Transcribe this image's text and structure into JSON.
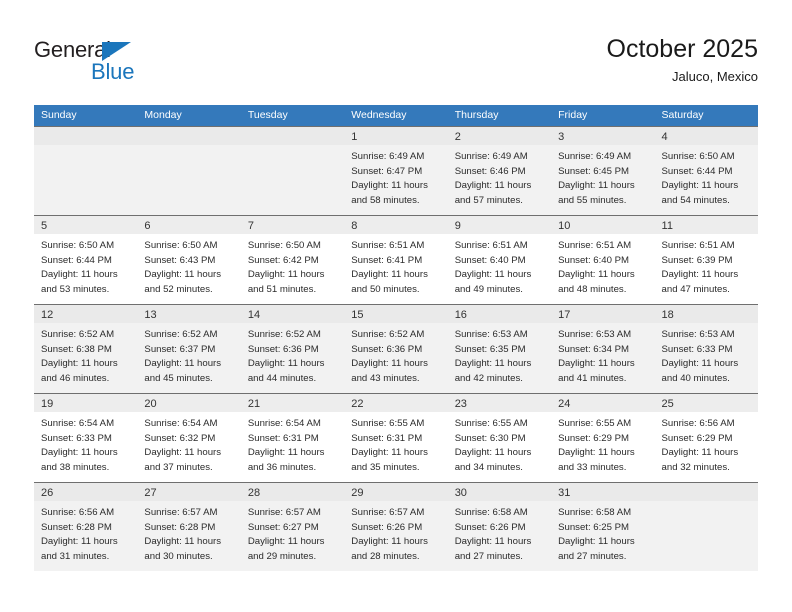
{
  "brand": {
    "name_part1": "General",
    "name_part2": "Blue",
    "triangle_color": "#1b76bc"
  },
  "header": {
    "title": "October 2025",
    "subtitle": "Jaluco, Mexico"
  },
  "theme": {
    "header_row_bg": "#3479bb",
    "header_row_text": "#ffffff",
    "shaded_row_bg": "#f2f2f2",
    "day_band_bg": "#ededed",
    "grid_line": "#6f6f6f"
  },
  "weekdays": [
    "Sunday",
    "Monday",
    "Tuesday",
    "Wednesday",
    "Thursday",
    "Friday",
    "Saturday"
  ],
  "weeks": [
    {
      "shaded": true,
      "days": [
        {
          "num": "",
          "lines": []
        },
        {
          "num": "",
          "lines": []
        },
        {
          "num": "",
          "lines": []
        },
        {
          "num": "1",
          "lines": [
            "Sunrise: 6:49 AM",
            "Sunset: 6:47 PM",
            "Daylight: 11 hours",
            "and 58 minutes."
          ]
        },
        {
          "num": "2",
          "lines": [
            "Sunrise: 6:49 AM",
            "Sunset: 6:46 PM",
            "Daylight: 11 hours",
            "and 57 minutes."
          ]
        },
        {
          "num": "3",
          "lines": [
            "Sunrise: 6:49 AM",
            "Sunset: 6:45 PM",
            "Daylight: 11 hours",
            "and 55 minutes."
          ]
        },
        {
          "num": "4",
          "lines": [
            "Sunrise: 6:50 AM",
            "Sunset: 6:44 PM",
            "Daylight: 11 hours",
            "and 54 minutes."
          ]
        }
      ]
    },
    {
      "shaded": false,
      "days": [
        {
          "num": "5",
          "lines": [
            "Sunrise: 6:50 AM",
            "Sunset: 6:44 PM",
            "Daylight: 11 hours",
            "and 53 minutes."
          ]
        },
        {
          "num": "6",
          "lines": [
            "Sunrise: 6:50 AM",
            "Sunset: 6:43 PM",
            "Daylight: 11 hours",
            "and 52 minutes."
          ]
        },
        {
          "num": "7",
          "lines": [
            "Sunrise: 6:50 AM",
            "Sunset: 6:42 PM",
            "Daylight: 11 hours",
            "and 51 minutes."
          ]
        },
        {
          "num": "8",
          "lines": [
            "Sunrise: 6:51 AM",
            "Sunset: 6:41 PM",
            "Daylight: 11 hours",
            "and 50 minutes."
          ]
        },
        {
          "num": "9",
          "lines": [
            "Sunrise: 6:51 AM",
            "Sunset: 6:40 PM",
            "Daylight: 11 hours",
            "and 49 minutes."
          ]
        },
        {
          "num": "10",
          "lines": [
            "Sunrise: 6:51 AM",
            "Sunset: 6:40 PM",
            "Daylight: 11 hours",
            "and 48 minutes."
          ]
        },
        {
          "num": "11",
          "lines": [
            "Sunrise: 6:51 AM",
            "Sunset: 6:39 PM",
            "Daylight: 11 hours",
            "and 47 minutes."
          ]
        }
      ]
    },
    {
      "shaded": true,
      "days": [
        {
          "num": "12",
          "lines": [
            "Sunrise: 6:52 AM",
            "Sunset: 6:38 PM",
            "Daylight: 11 hours",
            "and 46 minutes."
          ]
        },
        {
          "num": "13",
          "lines": [
            "Sunrise: 6:52 AM",
            "Sunset: 6:37 PM",
            "Daylight: 11 hours",
            "and 45 minutes."
          ]
        },
        {
          "num": "14",
          "lines": [
            "Sunrise: 6:52 AM",
            "Sunset: 6:36 PM",
            "Daylight: 11 hours",
            "and 44 minutes."
          ]
        },
        {
          "num": "15",
          "lines": [
            "Sunrise: 6:52 AM",
            "Sunset: 6:36 PM",
            "Daylight: 11 hours",
            "and 43 minutes."
          ]
        },
        {
          "num": "16",
          "lines": [
            "Sunrise: 6:53 AM",
            "Sunset: 6:35 PM",
            "Daylight: 11 hours",
            "and 42 minutes."
          ]
        },
        {
          "num": "17",
          "lines": [
            "Sunrise: 6:53 AM",
            "Sunset: 6:34 PM",
            "Daylight: 11 hours",
            "and 41 minutes."
          ]
        },
        {
          "num": "18",
          "lines": [
            "Sunrise: 6:53 AM",
            "Sunset: 6:33 PM",
            "Daylight: 11 hours",
            "and 40 minutes."
          ]
        }
      ]
    },
    {
      "shaded": false,
      "days": [
        {
          "num": "19",
          "lines": [
            "Sunrise: 6:54 AM",
            "Sunset: 6:33 PM",
            "Daylight: 11 hours",
            "and 38 minutes."
          ]
        },
        {
          "num": "20",
          "lines": [
            "Sunrise: 6:54 AM",
            "Sunset: 6:32 PM",
            "Daylight: 11 hours",
            "and 37 minutes."
          ]
        },
        {
          "num": "21",
          "lines": [
            "Sunrise: 6:54 AM",
            "Sunset: 6:31 PM",
            "Daylight: 11 hours",
            "and 36 minutes."
          ]
        },
        {
          "num": "22",
          "lines": [
            "Sunrise: 6:55 AM",
            "Sunset: 6:31 PM",
            "Daylight: 11 hours",
            "and 35 minutes."
          ]
        },
        {
          "num": "23",
          "lines": [
            "Sunrise: 6:55 AM",
            "Sunset: 6:30 PM",
            "Daylight: 11 hours",
            "and 34 minutes."
          ]
        },
        {
          "num": "24",
          "lines": [
            "Sunrise: 6:55 AM",
            "Sunset: 6:29 PM",
            "Daylight: 11 hours",
            "and 33 minutes."
          ]
        },
        {
          "num": "25",
          "lines": [
            "Sunrise: 6:56 AM",
            "Sunset: 6:29 PM",
            "Daylight: 11 hours",
            "and 32 minutes."
          ]
        }
      ]
    },
    {
      "shaded": true,
      "days": [
        {
          "num": "26",
          "lines": [
            "Sunrise: 6:56 AM",
            "Sunset: 6:28 PM",
            "Daylight: 11 hours",
            "and 31 minutes."
          ]
        },
        {
          "num": "27",
          "lines": [
            "Sunrise: 6:57 AM",
            "Sunset: 6:28 PM",
            "Daylight: 11 hours",
            "and 30 minutes."
          ]
        },
        {
          "num": "28",
          "lines": [
            "Sunrise: 6:57 AM",
            "Sunset: 6:27 PM",
            "Daylight: 11 hours",
            "and 29 minutes."
          ]
        },
        {
          "num": "29",
          "lines": [
            "Sunrise: 6:57 AM",
            "Sunset: 6:26 PM",
            "Daylight: 11 hours",
            "and 28 minutes."
          ]
        },
        {
          "num": "30",
          "lines": [
            "Sunrise: 6:58 AM",
            "Sunset: 6:26 PM",
            "Daylight: 11 hours",
            "and 27 minutes."
          ]
        },
        {
          "num": "31",
          "lines": [
            "Sunrise: 6:58 AM",
            "Sunset: 6:25 PM",
            "Daylight: 11 hours",
            "and 27 minutes."
          ]
        },
        {
          "num": "",
          "lines": []
        }
      ]
    }
  ]
}
